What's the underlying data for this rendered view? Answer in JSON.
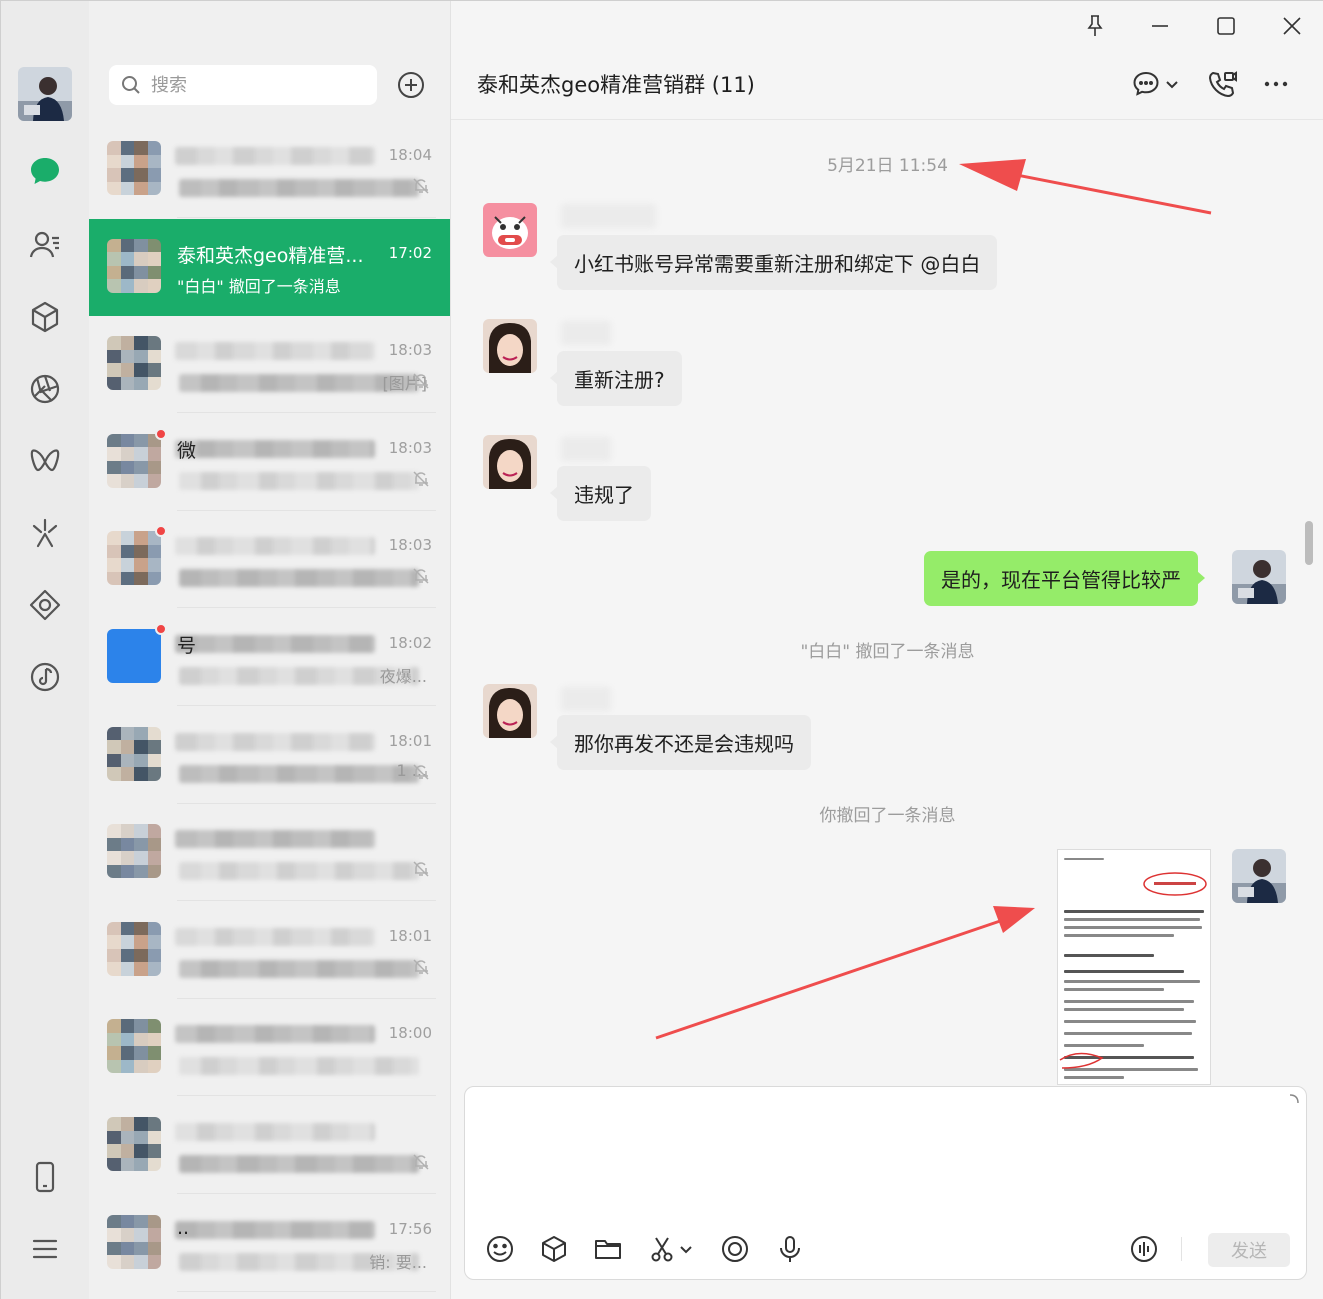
{
  "window": {
    "controls": [
      "pin",
      "minimize",
      "maximize",
      "close"
    ]
  },
  "rail": {
    "items": [
      {
        "icon": "chat-icon",
        "active": true
      },
      {
        "icon": "contacts-icon"
      },
      {
        "icon": "favorites-cube-icon"
      },
      {
        "icon": "moments-icon"
      },
      {
        "icon": "channels-icon"
      },
      {
        "icon": "discover-icon"
      },
      {
        "icon": "mini-programs-icon"
      },
      {
        "icon": "music-icon"
      }
    ],
    "bottom": [
      {
        "icon": "phone-icon"
      },
      {
        "icon": "menu-icon"
      }
    ]
  },
  "search": {
    "placeholder": "搜索"
  },
  "conversations": [
    {
      "name": "",
      "preview": "",
      "time": "18:04",
      "muted": true,
      "unread_dot": false,
      "active": false
    },
    {
      "name": "泰和英杰geo精准营...",
      "preview": "\"白白\" 撤回了一条消息",
      "time": "17:02",
      "muted": false,
      "unread_dot": false,
      "active": true
    },
    {
      "name": "",
      "preview": "[图片]",
      "time": "18:03",
      "muted": true,
      "unread_dot": false,
      "active": false
    },
    {
      "name": "微",
      "preview": "",
      "time": "18:03",
      "muted": true,
      "unread_dot": true,
      "active": false
    },
    {
      "name": "",
      "preview": "",
      "time": "18:03",
      "muted": true,
      "unread_dot": true,
      "active": false
    },
    {
      "name": "号",
      "preview": "夜爆...",
      "time": "18:02",
      "muted": false,
      "unread_dot": true,
      "active": false
    },
    {
      "name": "",
      "preview": "1 ...",
      "time": "18:01",
      "muted": true,
      "unread_dot": false,
      "active": false
    },
    {
      "name": "",
      "preview": "",
      "time": "",
      "muted": true,
      "unread_dot": false,
      "active": false
    },
    {
      "name": "",
      "preview": "",
      "time": "18:01",
      "muted": true,
      "unread_dot": false,
      "active": false
    },
    {
      "name": "",
      "preview": "",
      "time": "18:00",
      "muted": false,
      "unread_dot": false,
      "active": false
    },
    {
      "name": "",
      "preview": "",
      "time": "",
      "muted": true,
      "unread_dot": false,
      "active": false
    },
    {
      "name": "..",
      "preview": "销: 要...",
      "time": "17:56",
      "muted": false,
      "unread_dot": false,
      "active": false
    }
  ],
  "chat": {
    "title": "泰和英杰geo精准营销群 (11)",
    "timestamp": "5月21日 11:54",
    "messages": [
      {
        "side": "left",
        "text": "小红书账号异常需要重新注册和绑定下 @白白"
      },
      {
        "side": "left",
        "text": "重新注册?"
      },
      {
        "side": "left",
        "text": "违规了"
      },
      {
        "side": "right",
        "text": "是的，现在平台管得比较严"
      },
      {
        "side": "system",
        "text": "\"白白\" 撤回了一条消息"
      },
      {
        "side": "left",
        "text": "那你再发不还是会违规吗"
      },
      {
        "side": "system",
        "text": "你撤回了一条消息"
      },
      {
        "side": "right",
        "type": "image"
      }
    ],
    "send_label": "发送"
  },
  "colors": {
    "accent": "#1aad6a",
    "self_bubble": "#95ec69",
    "arrow": "#ef4d4d"
  }
}
